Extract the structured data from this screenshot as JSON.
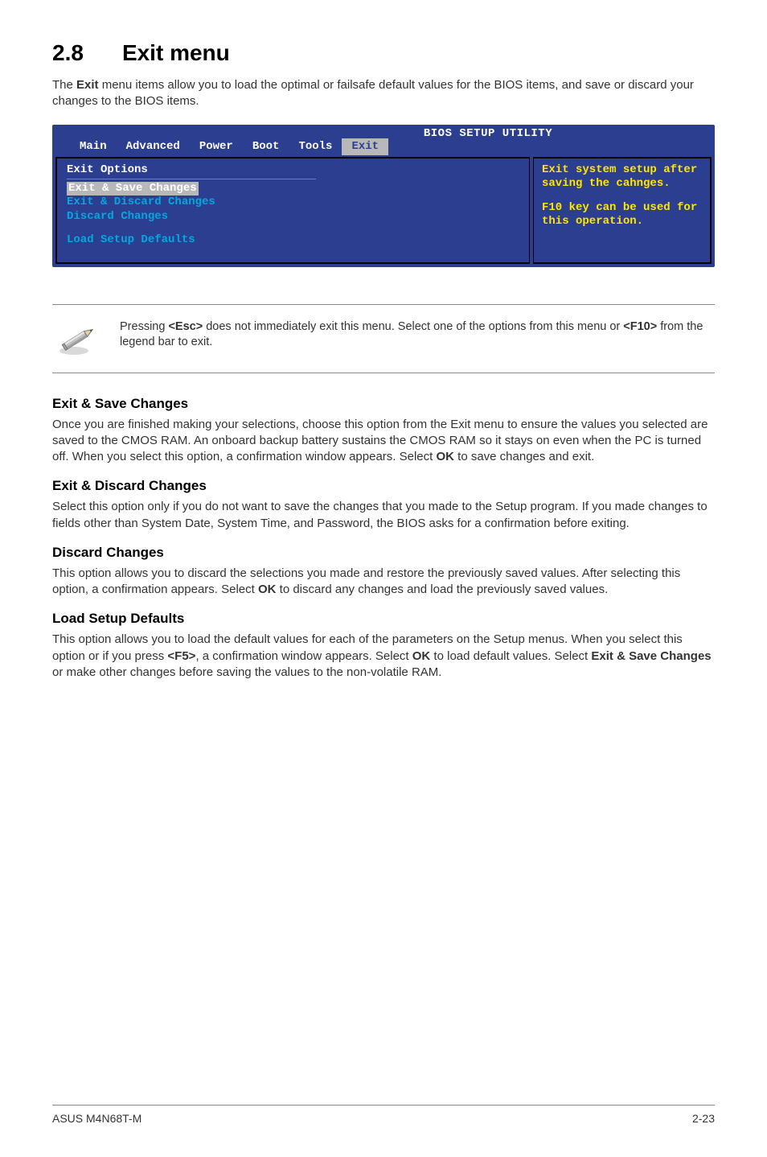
{
  "section": {
    "number": "2.8",
    "title": "Exit menu"
  },
  "intro": {
    "p1a": "The ",
    "p1b": "Exit",
    "p1c": " menu items allow you to load the optimal or failsafe default values for the BIOS items, and save or discard your changes to the BIOS items."
  },
  "bios": {
    "header": "BIOS SETUP UTILITY",
    "tabs": {
      "main": "Main",
      "advanced": "Advanced",
      "power": "Power",
      "boot": "Boot",
      "tools": "Tools",
      "exit": "Exit"
    },
    "left": {
      "heading": "Exit Options",
      "item_save": "Exit & Save Changes",
      "item_discard_exit": "Exit & Discard Changes",
      "item_discard": "Discard Changes",
      "item_defaults": "Load Setup Defaults"
    },
    "right": {
      "line1": "Exit system setup after saving the cahnges.",
      "line2": "F10 key can be used for this operation."
    }
  },
  "note": {
    "t1": "Pressing ",
    "t2": "<Esc>",
    "t3": " does not immediately exit this menu. Select one of the options from this menu or ",
    "t4": "<F10>",
    "t5": " from the legend bar to exit."
  },
  "subs": {
    "save": {
      "h": "Exit & Save Changes",
      "p": "Once you are finished making your selections, choose this option from the Exit menu to ensure the values you selected are saved to the CMOS RAM. An onboard backup battery sustains the CMOS RAM so it stays on even when the PC is turned off. When you select this option, a confirmation window appears. Select ",
      "b": "OK",
      "p2": " to save changes and exit."
    },
    "exit_discard": {
      "h": "Exit & Discard Changes",
      "p": "Select this option only if you do not want to save the changes that you made to the Setup program. If you made changes to fields other than System Date, System Time, and Password, the BIOS asks for a confirmation before exiting."
    },
    "discard": {
      "h": "Discard Changes",
      "p": "This option allows you to discard the selections you made and restore the previously saved values. After selecting this option, a confirmation appears. Select ",
      "b": "OK",
      "p2": " to discard any changes and load the previously saved values."
    },
    "defaults": {
      "h": "Load Setup Defaults",
      "p": "This option allows you to load the default values for each of the parameters on the Setup menus. When you select this option or if you press ",
      "b1": "<F5>",
      "p2": ", a confirmation window appears. Select ",
      "b2": "OK",
      "p3": " to load default values. Select ",
      "b3": "Exit & Save Changes",
      "p4": " or make other changes before saving the values to the non-volatile RAM."
    }
  },
  "footer": {
    "left": "ASUS M4N68T-M",
    "right": "2-23"
  }
}
